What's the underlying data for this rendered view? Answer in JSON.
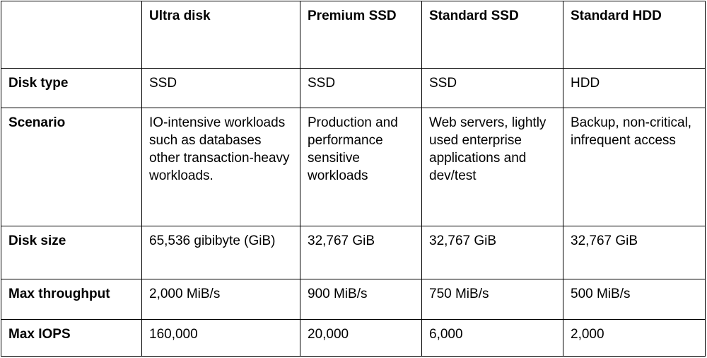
{
  "table": {
    "headers": [
      "",
      "Ultra disk",
      "Premium SSD",
      "Standard SSD",
      "Standard HDD"
    ],
    "rows": [
      {
        "label": "Disk type",
        "values": [
          "SSD",
          "SSD",
          "SSD",
          "HDD"
        ]
      },
      {
        "label": "Scenario",
        "values": [
          "IO-intensive workloads such as databases other transaction-heavy workloads.",
          "Production and performance sensitive workloads",
          "Web servers, lightly used enterprise applications and dev/test",
          "Backup, non-critical, infrequent access"
        ]
      },
      {
        "label": "Disk size",
        "values": [
          "65,536 gibibyte (GiB)",
          "32,767 GiB",
          "32,767 GiB",
          "32,767 GiB"
        ]
      },
      {
        "label": "Max throughput",
        "values": [
          "2,000 MiB/s",
          "900 MiB/s",
          "750 MiB/s",
          "500 MiB/s"
        ]
      },
      {
        "label": "Max IOPS",
        "values": [
          "160,000",
          "20,000",
          "6,000",
          "2,000"
        ]
      }
    ]
  }
}
